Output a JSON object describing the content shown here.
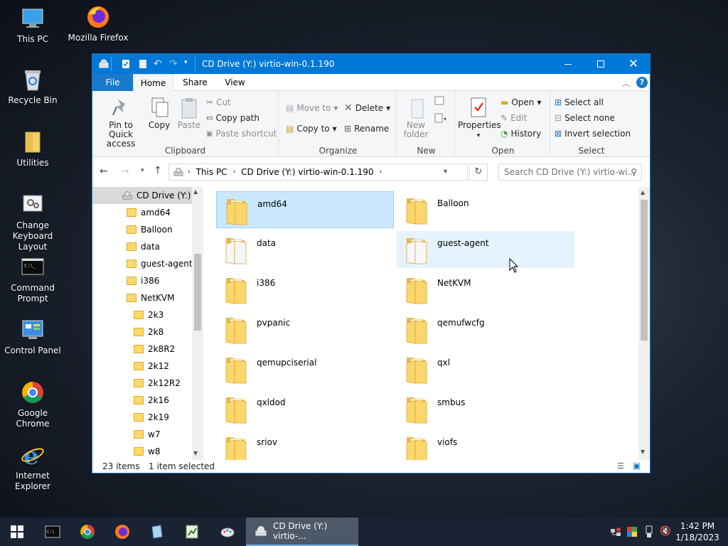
{
  "desktop": {
    "icons": [
      {
        "label": "This PC",
        "icon": "this-pc-icon"
      },
      {
        "label": "Mozilla Firefox",
        "icon": "firefox-icon"
      },
      {
        "label": "Recycle Bin",
        "icon": "recycle-bin-icon"
      },
      {
        "label": "Utilities",
        "icon": "folder-icon"
      },
      {
        "label": "Change Keyboard Layout",
        "icon": "keyboard-settings-icon"
      },
      {
        "label": "Command Prompt",
        "icon": "cmd-icon"
      },
      {
        "label": "Control Panel",
        "icon": "control-panel-icon"
      },
      {
        "label": "Google Chrome",
        "icon": "chrome-icon"
      },
      {
        "label": "Internet Explorer",
        "icon": "ie-icon"
      }
    ]
  },
  "window": {
    "title": "CD Drive (Y:) virtio-win-0.1.190",
    "tabs": [
      "File",
      "Home",
      "Share",
      "View"
    ],
    "ribbon": {
      "clipboard": {
        "label": "Clipboard",
        "pin": "Pin to Quick access",
        "copy": "Copy",
        "paste": "Paste",
        "cut": "Cut",
        "copy_path": "Copy path",
        "paste_shortcut": "Paste shortcut"
      },
      "organize": {
        "label": "Organize",
        "move_to": "Move to",
        "copy_to": "Copy to",
        "delete": "Delete",
        "rename": "Rename"
      },
      "new": {
        "label": "New",
        "new_folder": "New folder"
      },
      "open": {
        "label": "Open",
        "properties": "Properties",
        "open": "Open",
        "edit": "Edit",
        "history": "History"
      },
      "select": {
        "label": "Select",
        "select_all": "Select all",
        "select_none": "Select none",
        "invert": "Invert selection"
      }
    },
    "address": {
      "crumbs": [
        "This PC",
        "CD Drive (Y:) virtio-win-0.1.190"
      ],
      "search_placeholder": "Search CD Drive (Y:) virtio-wi..."
    },
    "nav_pane": {
      "root": "CD Drive (Y:) vi",
      "items": [
        "amd64",
        "Balloon",
        "data",
        "guest-agent",
        "i386",
        "NetKVM"
      ],
      "subitems": [
        "2k3",
        "2k8",
        "2k8R2",
        "2k12",
        "2k12R2",
        "2k16",
        "2k19",
        "w7",
        "w8"
      ]
    },
    "files": [
      {
        "name": "amd64",
        "state": "selected"
      },
      {
        "name": "Balloon",
        "state": ""
      },
      {
        "name": "data",
        "state": ""
      },
      {
        "name": "guest-agent",
        "state": "hover"
      },
      {
        "name": "i386",
        "state": ""
      },
      {
        "name": "NetKVM",
        "state": ""
      },
      {
        "name": "pvpanic",
        "state": ""
      },
      {
        "name": "qemufwcfg",
        "state": ""
      },
      {
        "name": "qemupciserial",
        "state": ""
      },
      {
        "name": "qxl",
        "state": ""
      },
      {
        "name": "qxldod",
        "state": ""
      },
      {
        "name": "smbus",
        "state": ""
      },
      {
        "name": "sriov",
        "state": ""
      },
      {
        "name": "viofs",
        "state": ""
      }
    ],
    "status": {
      "count": "23 items",
      "selected": "1 item selected"
    }
  },
  "taskbar": {
    "active_window": "CD Drive (Y:) virtio-...",
    "time": "1:42 PM",
    "date": "1/18/2023"
  },
  "colors": {
    "titlebar": "#0078d7",
    "selection": "#cce8ff",
    "hover": "#e5f3ff",
    "folder": "#ffd96b"
  }
}
